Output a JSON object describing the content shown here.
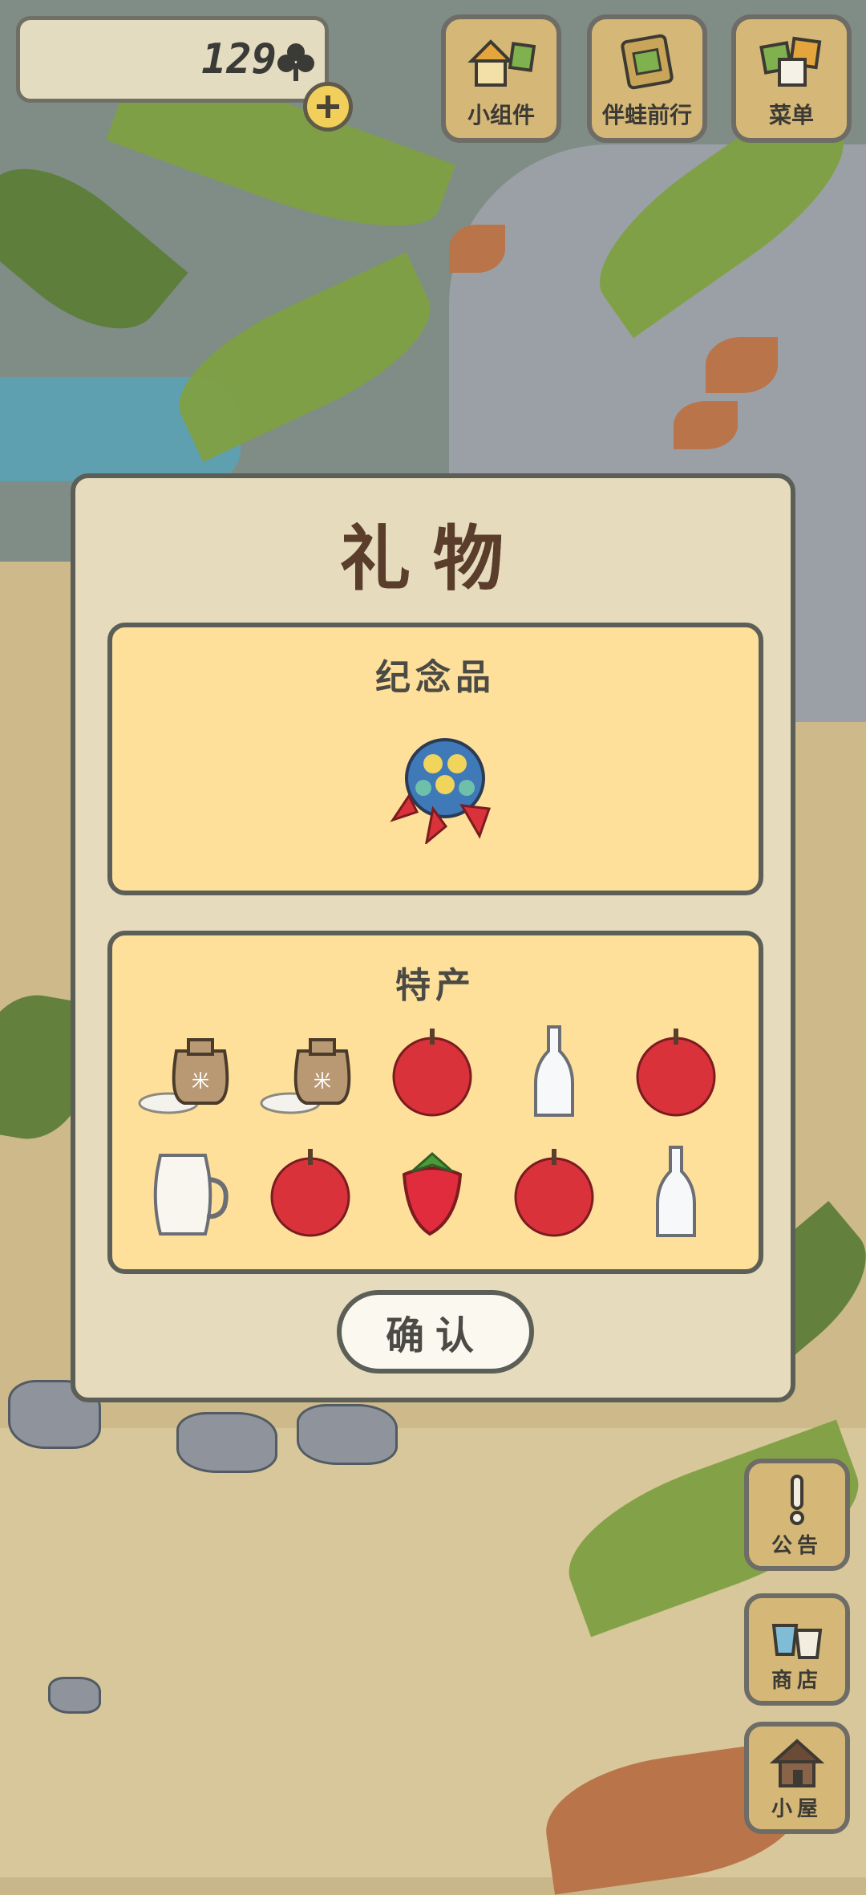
{
  "currency": {
    "count": "129",
    "icon": "clover-icon",
    "add_icon": "plus-icon"
  },
  "top_buttons": [
    {
      "label": "小组件",
      "icon": "widget-icon"
    },
    {
      "label": "伴蛙前行",
      "icon": "frog-journey-icon"
    },
    {
      "label": "菜单",
      "icon": "menu-icon"
    }
  ],
  "dialog": {
    "title": "礼物",
    "souvenir": {
      "title": "纪念品",
      "item": "temari-ball-icon"
    },
    "specialty": {
      "title": "特产",
      "items": [
        "rice-bag-icon",
        "rice-bag-icon",
        "apple-icon",
        "glass-bottle-icon",
        "apple-icon",
        "milk-jug-icon",
        "apple-icon",
        "strawberry-icon",
        "apple-icon",
        "glass-bottle-icon"
      ]
    },
    "confirm_label": "确认"
  },
  "side_buttons": [
    {
      "label": "公告",
      "icon": "exclamation-icon"
    },
    {
      "label": "商店",
      "icon": "shop-bags-icon"
    },
    {
      "label": "小屋",
      "icon": "house-icon"
    }
  ]
}
